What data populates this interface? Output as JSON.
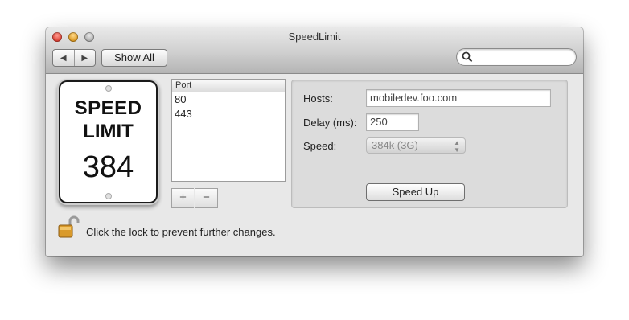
{
  "window": {
    "title": "SpeedLimit"
  },
  "toolbar": {
    "back_glyph": "◀",
    "forward_glyph": "▶",
    "show_all_label": "Show All",
    "search": {
      "value": "",
      "placeholder": ""
    }
  },
  "sign": {
    "line1": "SPEED",
    "line2": "LIMIT",
    "value": "384"
  },
  "ports": {
    "header": "Port",
    "rows": [
      "80",
      "443"
    ],
    "add_label": "+",
    "remove_label": "−"
  },
  "settings": {
    "hosts_label": "Hosts:",
    "hosts_value": "mobiledev.foo.com",
    "delay_label": "Delay (ms):",
    "delay_value": "250",
    "speed_label": "Speed:",
    "speed_value": "384k (3G)",
    "speed_up_label": "Speed Up"
  },
  "lock": {
    "message": "Click the lock to prevent further changes.",
    "state": "unlocked"
  },
  "colors": {
    "lock_gold": "#d99a2b",
    "title_bar": "#cfcfcf"
  },
  "icons": [
    "close-button",
    "minimize-button",
    "zoom-button",
    "search-icon",
    "lock-icon"
  ]
}
